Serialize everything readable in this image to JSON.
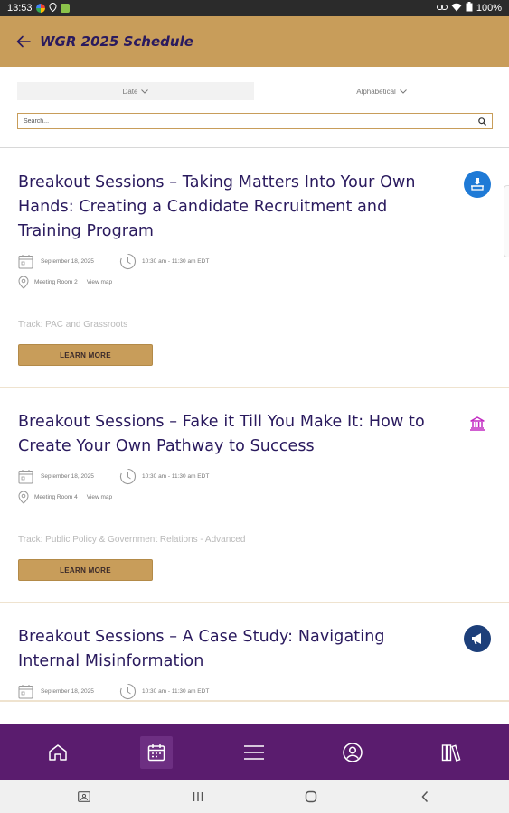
{
  "status_bar": {
    "time": "13:53",
    "battery": "100%"
  },
  "header": {
    "title": "WGR 2025 Schedule"
  },
  "filters": {
    "date_label": "Date",
    "alpha_label": "Alphabetical",
    "search_placeholder": "Search..."
  },
  "sessions": [
    {
      "title": "Breakout Sessions – Taking Matters Into Your Own Hands: Creating a Candidate Recruitment and Training Program",
      "date": "September 18, 2025",
      "time": "10:30 am - 11:30 am EDT",
      "location": "Meeting Room 2",
      "view_map": "View map",
      "track": "Track: PAC and Grassroots",
      "button": "LEARN MORE",
      "icon": "ballot-box-icon",
      "icon_color": "#1f7ad6"
    },
    {
      "title": "Breakout Sessions – Fake it Till You Make It: How to Create Your Own Pathway to Success",
      "date": "September 18, 2025",
      "time": "10:30 am - 11:30 am EDT",
      "location": "Meeting Room 4",
      "view_map": "View map",
      "track": "Track: Public Policy & Government Relations - Advanced",
      "button": "LEARN MORE",
      "icon": "capitol-building-icon",
      "icon_color": "#c229c2"
    },
    {
      "title": "Breakout Sessions – A Case Study: Navigating Internal Misinformation",
      "date": "September 18, 2025",
      "time": "10:30 am - 11:30 am EDT",
      "icon": "megaphone-icon",
      "icon_color": "#1d3f7a"
    }
  ],
  "bottom_nav": [
    "home-icon",
    "calendar-icon",
    "menu-icon",
    "profile-icon",
    "library-icon"
  ],
  "colors": {
    "header_bg": "#c89d5a",
    "nav_bg": "#5a1c6e",
    "title_text": "#2a1a5e"
  }
}
